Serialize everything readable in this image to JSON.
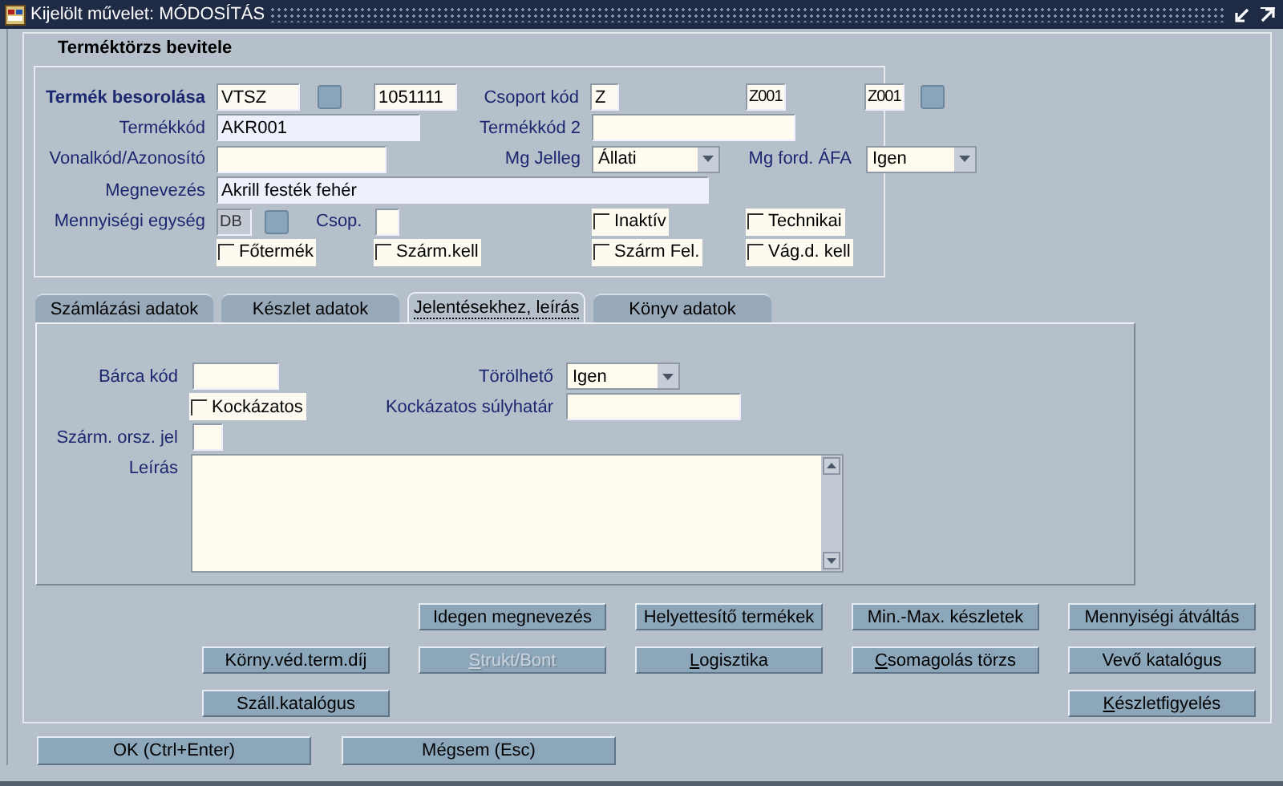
{
  "window": {
    "title": "Kijelölt művelet: MÓDOSÍTÁS"
  },
  "form_title": "Terméktörzs bevitele",
  "header": {
    "classification": {
      "label": "Termék besorolása",
      "type": "VTSZ",
      "code": "1051111"
    },
    "group_code": {
      "label": "Csoport kód",
      "values": [
        "Z",
        "Z001",
        "Z001"
      ]
    },
    "product_code": {
      "label": "Termékkód",
      "value": "AKR001"
    },
    "product_code_2": {
      "label": "Termékkód 2"
    },
    "barcode": {
      "label": "Vonalkód/Azonosító"
    },
    "mg_type": {
      "label": "Mg Jelleg",
      "value": "Állati"
    },
    "vat": {
      "label": "Mg ford. ÁFA",
      "value": "Igen"
    },
    "name": {
      "label": "Megnevezés",
      "value": "Akrill festék fehér"
    },
    "unit": {
      "label": "Mennyiségi egység",
      "value": "DB"
    },
    "group": {
      "label": "Csop."
    },
    "checkboxes": [
      {
        "label": "Inaktív",
        "checked": false
      },
      {
        "label": "Technikai",
        "checked": false
      },
      {
        "label": "Főtermék",
        "checked": false
      },
      {
        "label": "Szárm.kell",
        "checked": false
      },
      {
        "label": "Szárm Fel.",
        "checked": false
      },
      {
        "label": "Vág.d. kell",
        "checked": false
      }
    ]
  },
  "tabs": [
    {
      "label": "Számlázási adatok",
      "selected": false
    },
    {
      "label": "Készlet adatok",
      "selected": false
    },
    {
      "label": "Jelentésekhez, leírás",
      "selected": true
    },
    {
      "label": "Könyv adatok",
      "selected": false
    }
  ],
  "tab_panel": {
    "tag_code": {
      "label": "Bárca kód"
    },
    "deletable": {
      "label": "Törölhető",
      "value": "Igen"
    },
    "risky": {
      "label": "Kockázatos",
      "checked": false
    },
    "risk_limit": {
      "label": "Kockázatos súlyhatár"
    },
    "origin_country": {
      "label": "Szárm. orsz. jel"
    },
    "description": {
      "label": "Leírás"
    }
  },
  "buttons": [
    {
      "label": "Idegen megnevezés",
      "disabled": false,
      "mnemonic": false
    },
    {
      "label": "Helyettesítő termékek",
      "disabled": false,
      "mnemonic": false
    },
    {
      "label": "Min.-Max. készletek",
      "disabled": false,
      "mnemonic": false
    },
    {
      "label": "Mennyiségi átváltás",
      "disabled": false,
      "mnemonic": false
    },
    {
      "label": "Körny.véd.term.díj",
      "disabled": false,
      "mnemonic": false
    },
    {
      "label": "Strukt/Bont",
      "disabled": true,
      "mnemonic": true
    },
    {
      "label": "Logisztika",
      "disabled": false,
      "mnemonic": true
    },
    {
      "label": "Csomagolás törzs",
      "disabled": false,
      "mnemonic": true
    },
    {
      "label": "Vevő katalógus",
      "disabled": false,
      "mnemonic": false
    },
    {
      "label": "Száll.katalógus",
      "disabled": false,
      "mnemonic": false
    },
    {
      "label": "Készletfigyelés",
      "disabled": false,
      "mnemonic": true
    }
  ],
  "footer_buttons": [
    "OK (Ctrl+Enter)",
    "Mégsem (Esc)"
  ]
}
